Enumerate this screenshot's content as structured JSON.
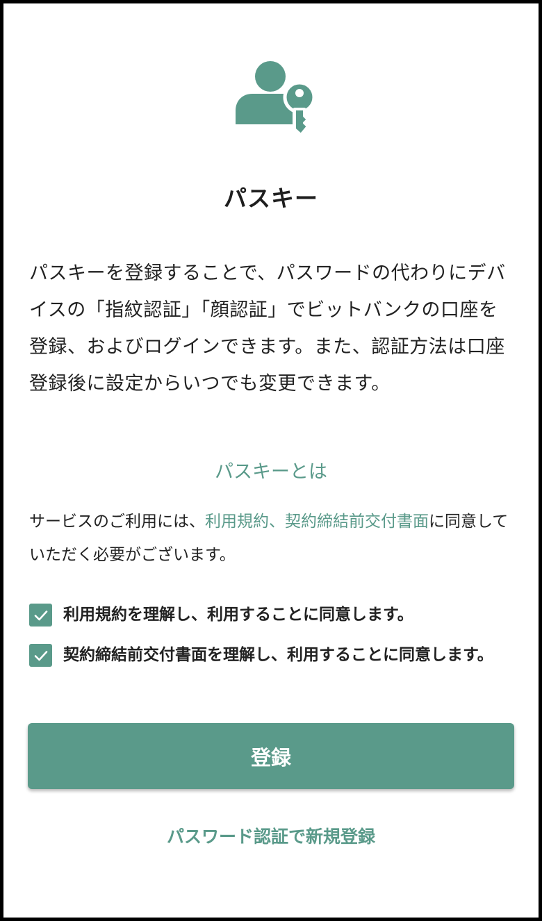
{
  "brand": {
    "accent_color": "#5a9a8a",
    "text_color": "#222222"
  },
  "hero": {
    "icon": "user-key-icon"
  },
  "title": "パスキー",
  "description": "パスキーを登録することで、パスワードの代わりにデバイスの「指紋認証」「顔認証」でビットバンクの口座を登録、およびログインできます。また、認証方法は口座登録後に設定からいつでも変更できます。",
  "about_link": "パスキーとは",
  "consent": {
    "prefix": "サービスのご利用には、",
    "terms_link": "利用規約、",
    "pre_contract_link": "契約締結前交付書面",
    "suffix": "に同意していただく必要がございます。"
  },
  "checkboxes": [
    {
      "label": "利用規約を理解し、利用することに同意します。",
      "checked": true
    },
    {
      "label": "契約締結前交付書面を理解し、利用することに同意します。",
      "checked": true
    }
  ],
  "register_button": "登録",
  "password_register_link": "パスワード認証で新規登録"
}
